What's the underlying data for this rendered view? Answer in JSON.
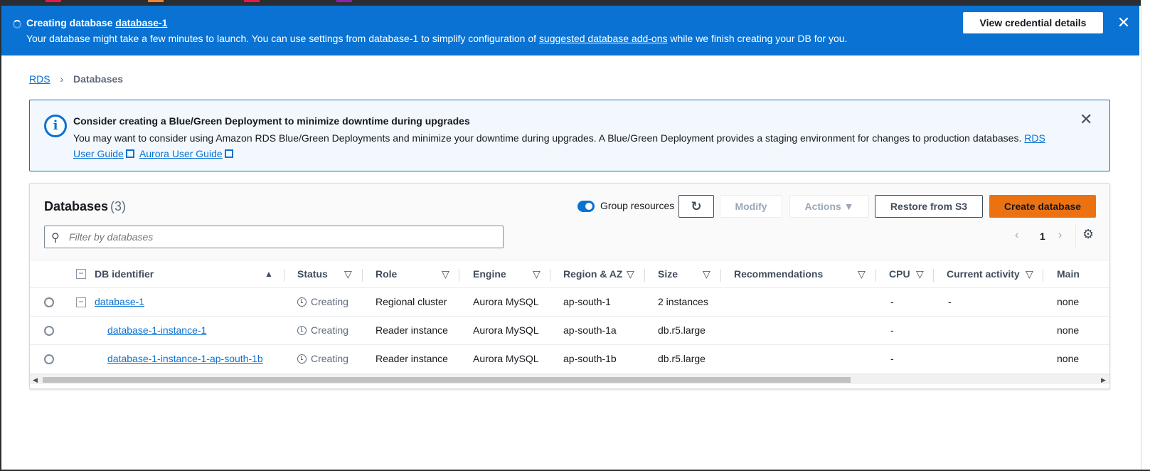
{
  "flash": {
    "title_prefix": "Creating database",
    "title_link": "database-1",
    "message_before": "Your database might take a few minutes to launch. You can use settings from database-1 to simplify configuration of ",
    "message_link": "suggested database add-ons",
    "message_after": " while we finish creating your DB for you.",
    "button_label": "View credential details",
    "close_glyph": "✕"
  },
  "breadcrumb": {
    "root": "RDS",
    "separator": "›",
    "current": "Databases"
  },
  "info": {
    "icon_glyph": "i",
    "heading": "Consider creating a Blue/Green Deployment to minimize downtime during upgrades",
    "body": "You may want to consider using Amazon RDS Blue/Green Deployments and minimize your downtime during upgrades. A Blue/Green Deployment provides a staging environment for changes to production databases. ",
    "link1": "RDS User Guide",
    "link2": "Aurora User Guide",
    "close_glyph": "✕"
  },
  "databases": {
    "title": "Databases",
    "count": "(3)",
    "group_toggle_label": "Group resources",
    "refresh_glyph": "↻",
    "modify_label": "Modify",
    "actions_label": "Actions ▼",
    "restore_label": "Restore from S3",
    "create_label": "Create database",
    "search_placeholder": "Filter by databases",
    "search_glyph": "⚲",
    "page_prev": "‹",
    "page_current": "1",
    "page_next": "›",
    "settings_glyph": "⚙",
    "columns": {
      "db_identifier": "DB identifier",
      "status": "Status",
      "role": "Role",
      "engine": "Engine",
      "region": "Region & AZ",
      "size": "Size",
      "recommendations": "Recommendations",
      "cpu": "CPU",
      "activity": "Current activity",
      "maintenance": "Main"
    },
    "sort_asc_glyph": "▲",
    "filter_glyph": "▽",
    "rows": [
      {
        "id": "database-1",
        "status": "Creating",
        "role": "Regional cluster",
        "engine": "Aurora MySQL",
        "region": "ap-south-1",
        "size": "2 instances",
        "recommendations": "",
        "cpu": "-",
        "activity": "-",
        "maintenance": "none"
      },
      {
        "id": "database-1-instance-1",
        "status": "Creating",
        "role": "Reader instance",
        "engine": "Aurora MySQL",
        "region": "ap-south-1a",
        "size": "db.r5.large",
        "recommendations": "",
        "cpu": "-",
        "activity": "",
        "maintenance": "none"
      },
      {
        "id": "database-1-instance-1-ap-south-1b",
        "status": "Creating",
        "role": "Reader instance",
        "engine": "Aurora MySQL",
        "region": "ap-south-1b",
        "size": "db.r5.large",
        "recommendations": "",
        "cpu": "-",
        "activity": "",
        "maintenance": "none"
      }
    ]
  },
  "colors": {
    "flash_bg": "#0972d3",
    "primary_button": "#ec7211",
    "link": "#0972d3",
    "info_bg": "#f2f8fd"
  }
}
